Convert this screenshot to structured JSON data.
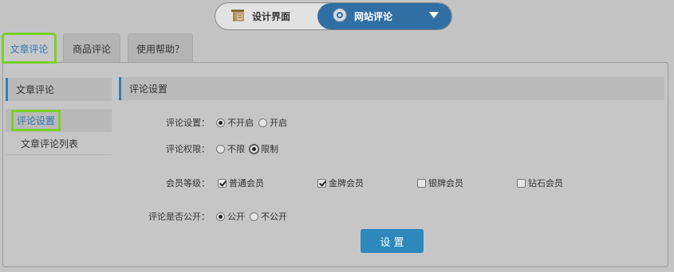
{
  "switcher": {
    "design_label": "设计界面",
    "web_label": "网站评论"
  },
  "tabs": [
    {
      "label": "文章评论"
    },
    {
      "label": "商品评论"
    },
    {
      "label": "使用帮助？"
    }
  ],
  "sidebar": {
    "header": "文章评论",
    "items": [
      {
        "label": "评论设置"
      },
      {
        "label": "文章评论列表"
      }
    ]
  },
  "content": {
    "header": "评论设置",
    "comment_setting": {
      "label": "评论设置：",
      "options": [
        "不开启",
        "开启"
      ],
      "selected": "不开启"
    },
    "comment_permission": {
      "label": "评论权限：",
      "options": [
        "不限",
        "限制"
      ],
      "selected": "限制"
    },
    "member_level": {
      "label": "会员等级：",
      "options": [
        {
          "label": "普通会员",
          "checked": true
        },
        {
          "label": "金牌会员",
          "checked": true
        },
        {
          "label": "银牌会员",
          "checked": false
        },
        {
          "label": "钻石会员",
          "checked": false
        }
      ]
    },
    "comment_public": {
      "label": "评论是否公开：",
      "options": [
        "公开",
        "不公开"
      ],
      "selected": "公开"
    },
    "submit_label": "设 置"
  },
  "colors": {
    "accent_blue": "#2f7fbd",
    "highlight_green": "#7ad02a",
    "button_blue": "#2c88bd"
  }
}
